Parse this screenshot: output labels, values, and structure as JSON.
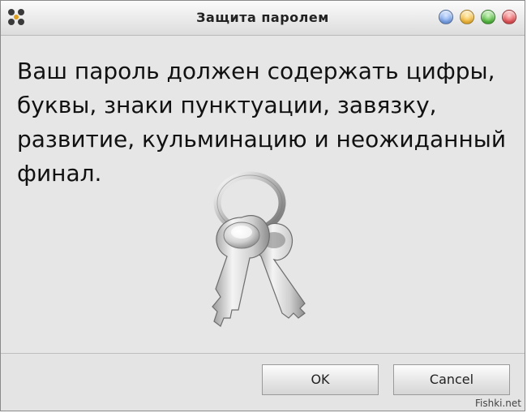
{
  "dialog": {
    "title": "Защита паролем",
    "message": "Ваш пароль должен содержать цифры, буквы, знаки пунктуации, завязку, развитие, кульминацию и неожиданный финал.",
    "icon": "keys-icon"
  },
  "window_controls": [
    {
      "name": "blue",
      "color": "#6f9be6"
    },
    {
      "name": "yellow",
      "color": "#f2b32a"
    },
    {
      "name": "green",
      "color": "#46b332"
    },
    {
      "name": "red",
      "color": "#e0474b"
    }
  ],
  "buttons": {
    "ok_label": "OK",
    "cancel_label": "Cancel"
  },
  "watermark": "Fishki.net"
}
